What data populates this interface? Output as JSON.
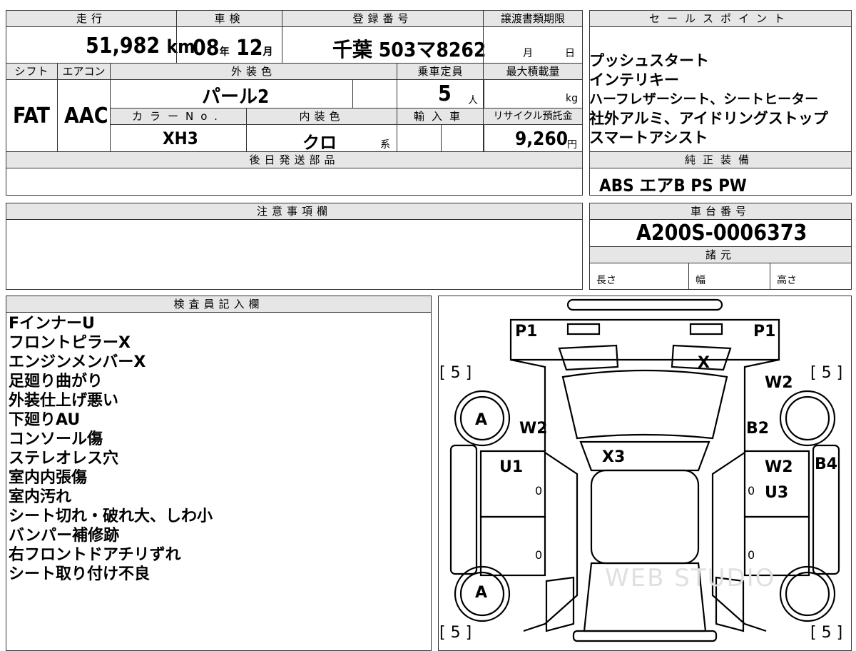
{
  "header": {
    "mileage_label": "走行",
    "inspection_label": "車検",
    "registration_label": "登録番号",
    "transfer_deadline_label": "譲渡書類期限",
    "sales_points_label": "セールスポイント"
  },
  "vehicle": {
    "mileage_value": "51,982",
    "mileage_unit": "km",
    "inspection_year": "08",
    "year_unit": "年",
    "inspection_month": "12",
    "month_unit": "月",
    "registration_number": "千葉 503マ8262",
    "transfer_month_unit": "月",
    "transfer_day_unit": "日"
  },
  "row2": {
    "shift_label": "シフト",
    "aircon_label": "エアコン",
    "exterior_color_label": "外装色",
    "capacity_label": "乗車定員",
    "max_load_label": "最大積載量",
    "shift_value": "FAT",
    "aircon_value": "AAC",
    "exterior_color_value": "パール2",
    "capacity_value": "5",
    "capacity_unit": "人",
    "max_load_unit": "kg"
  },
  "row3": {
    "color_no_label": "カラーNo.",
    "interior_color_label": "内装色",
    "import_label": "輸入車",
    "recycle_label": "リサイクル預託金",
    "color_no_value": "XH3",
    "interior_color_value": "クロ",
    "interior_suffix": "系",
    "recycle_value": "9,260",
    "recycle_unit": "円"
  },
  "sales_points": [
    "プッシュスタート",
    "インテリキー",
    "ハーフレザーシート、シートヒーター",
    "社外アルミ、アイドリングストップ",
    "スマートアシスト"
  ],
  "later_parts_label": "後日発送部品",
  "genuine_equipment_label": "純正装備",
  "genuine_equipment_value": "ABS エアB PS PW",
  "notes_label": "注意事項欄",
  "chassis_label": "車台番号",
  "chassis_value": "A200S-0006373",
  "specs_label": "諸元",
  "specs": {
    "length": "長さ",
    "width": "幅",
    "height": "高さ"
  },
  "inspector_label": "検査員記入欄",
  "inspector_notes": [
    "FインナーU",
    "フロントピラーX",
    "エンジンメンバーX",
    "足廻り曲がり",
    "外装仕上げ悪い",
    "下廻りAU",
    "コンソール傷",
    "ステレオレス穴",
    "室内内張傷",
    "室内汚れ",
    "シート切れ・破れ大、しわ小",
    "バンパー補修跡",
    "右フロントドアチリずれ",
    "シート取り付け不良"
  ],
  "diagram": {
    "p1_left": "P1",
    "p1_right": "P1",
    "x_top": "X",
    "tire_tl": "[ 5 ]",
    "tire_tr": "[ 5 ]",
    "tire_bl": "[ 5 ]",
    "tire_br": "[ 5 ]",
    "w2_left": "W2",
    "w2_right_top": "W2",
    "b2": "B2",
    "a_top": "A",
    "a_bottom": "A",
    "x3": "X3",
    "u1": "U1",
    "w2_right_mid": "W2",
    "b4": "B4",
    "u3": "U3",
    "zero_1": "0",
    "zero_2": "0",
    "zero_3": "0",
    "zero_4": "0",
    "watermark": "WEB STUDIO"
  }
}
